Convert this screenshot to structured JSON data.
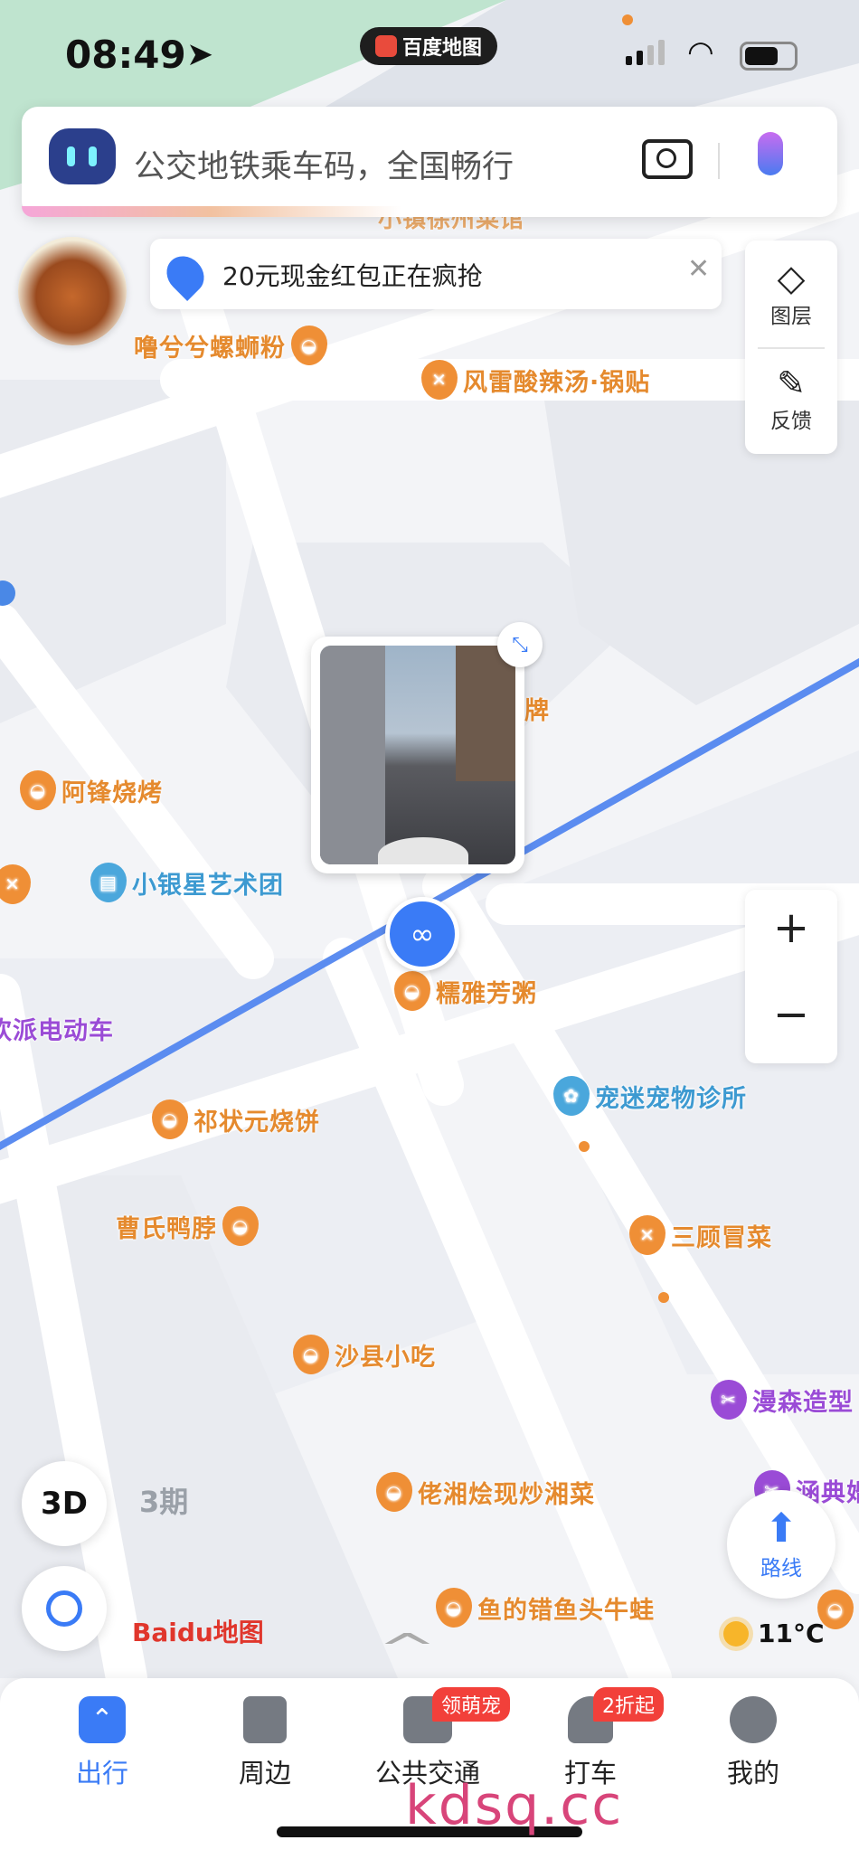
{
  "status_bar": {
    "time": "08:49",
    "app_pill": "百度地图"
  },
  "search": {
    "placeholder": "公交地铁乘车码，全国畅行"
  },
  "banner": {
    "text": "20元现金红包正在疯抢"
  },
  "side_panel": {
    "layers_label": "图层",
    "feedback_label": "反馈"
  },
  "map": {
    "pois": [
      {
        "id": "poi-luosifen",
        "label": "噜兮兮螺蛳粉",
        "kind": "orange",
        "icon": "bowl-icon"
      },
      {
        "id": "poi-fenglei",
        "label": "风雷酸辣汤·锅贴",
        "kind": "orange",
        "icon": "fork-knife-icon"
      },
      {
        "id": "poi-afeng",
        "label": "阿锋烧烤",
        "kind": "orange",
        "icon": "bowl-icon"
      },
      {
        "id": "poi-yinxing",
        "label": "小银星艺术团",
        "kind": "blue",
        "icon": "book-icon"
      },
      {
        "id": "poi-nuoya",
        "label": "糯雅芳粥",
        "kind": "orange",
        "icon": "bowl-icon"
      },
      {
        "id": "poi-huanpai",
        "label": "欢派电动车",
        "kind": "purple",
        "icon": "none"
      },
      {
        "id": "poi-chongmi",
        "label": "宠迷宠物诊所",
        "kind": "blue",
        "icon": "paw-icon"
      },
      {
        "id": "poi-qizhuangyuan",
        "label": "祁状元烧饼",
        "kind": "orange",
        "icon": "bowl-icon"
      },
      {
        "id": "poi-caoshi",
        "label": "曹氏鸭脖",
        "kind": "orange",
        "icon": "bowl-icon"
      },
      {
        "id": "poi-sangu",
        "label": "三顾冒菜",
        "kind": "orange",
        "icon": "fork-knife-icon"
      },
      {
        "id": "poi-shaxian",
        "label": "沙县小吃",
        "kind": "orange",
        "icon": "bowl-icon"
      },
      {
        "id": "poi-mansen",
        "label": "漫森造型",
        "kind": "purple",
        "icon": "scissors-icon"
      },
      {
        "id": "poi-hanxiang",
        "label": "佬湘烩现炒湘菜",
        "kind": "orange",
        "icon": "bowl-icon"
      },
      {
        "id": "poi-yudecuo",
        "label": "鱼的错鱼头牛蛙",
        "kind": "orange",
        "icon": "bowl-icon"
      },
      {
        "id": "poi-handian",
        "label": "涵典婚",
        "kind": "purple",
        "icon": "scissors-icon"
      }
    ],
    "partial_labels": {
      "top_overlap": "小镇徐州菜馆",
      "pai": "牌"
    },
    "district_label": "3期",
    "logo": "Baidu地图"
  },
  "controls": {
    "btn_3d": "3D",
    "route_label": "路线",
    "weather": "11°C",
    "zoom_in": "+",
    "zoom_out": "−"
  },
  "nav": {
    "items": [
      {
        "label": "出行",
        "badge": ""
      },
      {
        "label": "周边",
        "badge": ""
      },
      {
        "label": "公共交通",
        "badge": "领萌宠"
      },
      {
        "label": "打车",
        "badge": "2折起"
      },
      {
        "label": "我的",
        "badge": ""
      }
    ]
  },
  "watermark": "kdsq.cc",
  "colors": {
    "accent_blue": "#3a7bf6",
    "poi_orange": "#ef8f36",
    "road_line": "#5b8cf0"
  }
}
